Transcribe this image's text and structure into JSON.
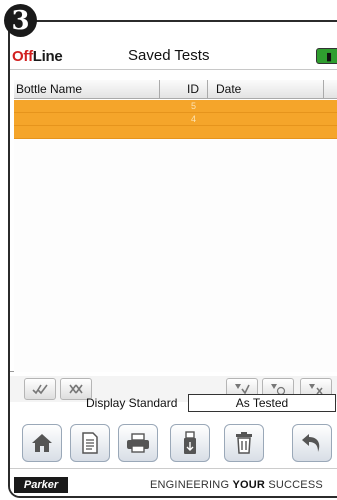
{
  "step_badge": "3",
  "header": {
    "brand_off": "Off",
    "brand_line": "Line",
    "title": "Saved Tests"
  },
  "table": {
    "columns": [
      "Bottle Name",
      "ID",
      "Date"
    ],
    "rows": [
      {
        "name": "",
        "id": "5",
        "date": ""
      },
      {
        "name": "",
        "id": "4",
        "date": ""
      },
      {
        "name": "",
        "id": "",
        "date": ""
      }
    ],
    "selected_row_color": "#f5a52a"
  },
  "toolbar": {
    "icons": [
      "select-all-icon",
      "deselect-all-icon",
      "filter-icon",
      "filter-time-icon",
      "filter-clear-icon"
    ]
  },
  "display": {
    "label": "Display Standard",
    "value": "As Tested"
  },
  "actions": {
    "icons": [
      "home-icon",
      "document-icon",
      "print-icon",
      "usb-export-icon",
      "trash-icon",
      "back-icon"
    ]
  },
  "footer": {
    "logo": "Parker",
    "tagline_normal": "ENGINEERING ",
    "tagline_bold": "YOUR",
    "tagline_end": " SUCCESS"
  },
  "colors": {
    "brand_red": "#d21f1f",
    "battery_green": "#2f9e2f",
    "highlight_orange": "#f5a52a"
  }
}
